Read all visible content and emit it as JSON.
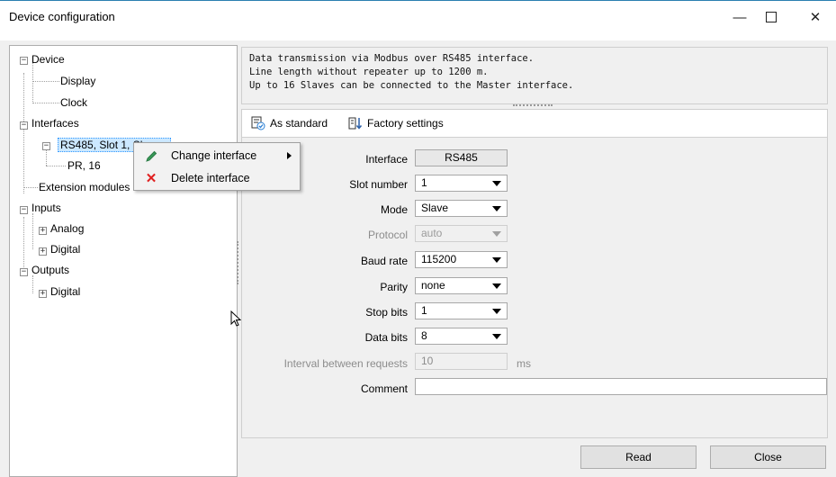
{
  "window": {
    "title": "Device configuration",
    "min_icon": "minimize-icon",
    "max_icon": "maximize-icon",
    "close_icon": "close-icon"
  },
  "tree": {
    "device": "Device",
    "display": "Display",
    "clock": "Clock",
    "interfaces": "Interfaces",
    "rs485": "RS485, Slot 1, Slave",
    "pr16": "PR, 16",
    "extension": "Extension modules",
    "inputs": "Inputs",
    "analog": "Analog",
    "inputs_digital": "Digital",
    "outputs": "Outputs",
    "outputs_digital": "Digital"
  },
  "description": [
    "Data transmission via Modbus over RS485 interface.",
    "Line length without repeater up to 1200 m.",
    "Up to 16 Slaves can be connected to the Master interface."
  ],
  "toolbar": {
    "as_standard": "As standard",
    "factory_settings": "Factory settings"
  },
  "form": {
    "interface": {
      "label": "Interface",
      "value": "RS485"
    },
    "slot": {
      "label": "Slot number",
      "value": "1"
    },
    "mode": {
      "label": "Mode",
      "value": "Slave"
    },
    "protocol": {
      "label": "Protocol",
      "value": "auto"
    },
    "baud": {
      "label": "Baud rate",
      "value": "115200"
    },
    "parity": {
      "label": "Parity",
      "value": "none"
    },
    "stopbits": {
      "label": "Stop bits",
      "value": "1"
    },
    "databits": {
      "label": "Data bits",
      "value": "8"
    },
    "interval": {
      "label": "Interval between requests",
      "value": "10",
      "unit": "ms"
    },
    "comment": {
      "label": "Comment",
      "value": ""
    }
  },
  "buttons": {
    "read": "Read",
    "close": "Close"
  },
  "context_menu": {
    "change": "Change interface",
    "delete": "Delete interface"
  }
}
